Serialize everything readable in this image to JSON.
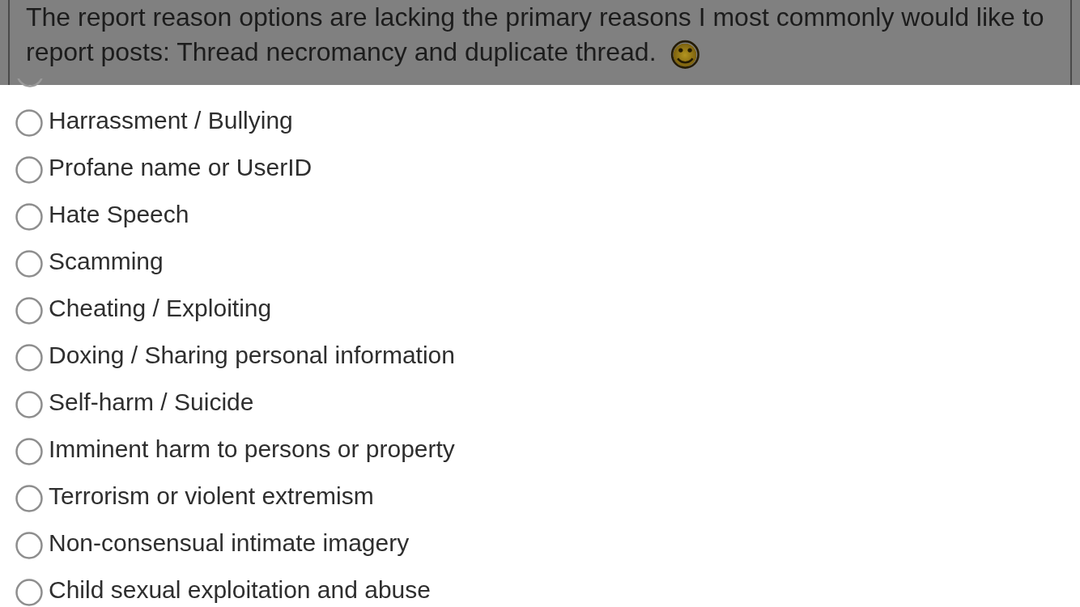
{
  "quoted_post": {
    "text": "The report reason options are lacking the primary reasons I most commonly would like to report posts: Thread necromancy and duplicate thread.",
    "emoji": "☺"
  },
  "report_reasons": {
    "partial_option": {
      "selected": false
    },
    "options": [
      {
        "label": "Harrassment / Bullying",
        "selected": false
      },
      {
        "label": "Profane name or UserID",
        "selected": false
      },
      {
        "label": "Hate Speech",
        "selected": false
      },
      {
        "label": "Scamming",
        "selected": false
      },
      {
        "label": "Cheating / Exploiting",
        "selected": false
      },
      {
        "label": "Doxing / Sharing personal information",
        "selected": false
      },
      {
        "label": "Self-harm / Suicide",
        "selected": false
      },
      {
        "label": "Imminent harm to persons or property",
        "selected": false
      },
      {
        "label": "Terrorism or violent extremism",
        "selected": false
      },
      {
        "label": "Non-consensual intimate imagery",
        "selected": false
      },
      {
        "label": "Child sexual exploitation and abuse",
        "selected": false
      }
    ]
  }
}
